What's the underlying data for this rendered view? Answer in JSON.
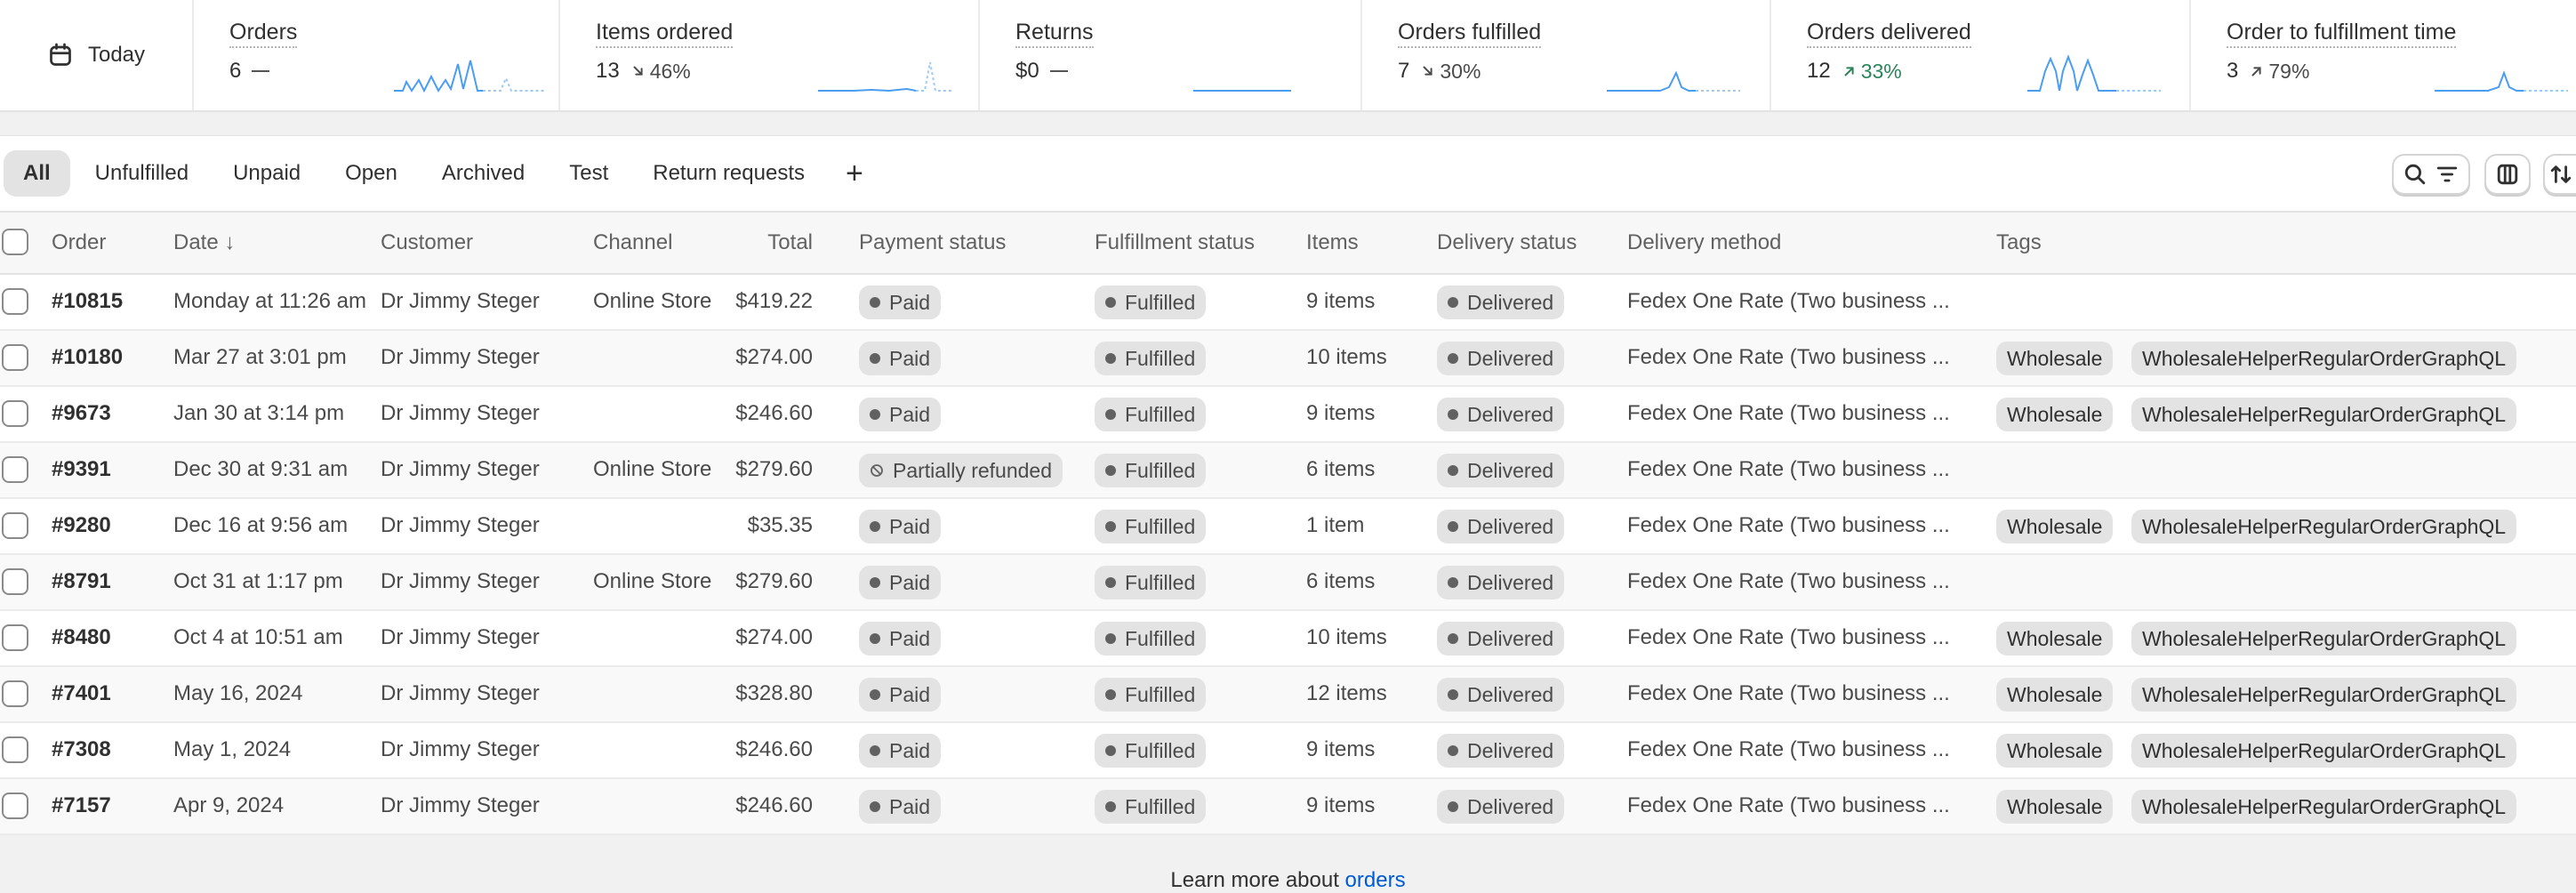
{
  "today_label": "Today",
  "metrics": [
    {
      "title": "Orders",
      "value": "6",
      "change": "",
      "trend": "none"
    },
    {
      "title": "Items ordered",
      "value": "13",
      "change": "46%",
      "trend": "down"
    },
    {
      "title": "Returns",
      "value": "$0",
      "change": "",
      "trend": "none"
    },
    {
      "title": "Orders fulfilled",
      "value": "7",
      "change": "30%",
      "trend": "down"
    },
    {
      "title": "Orders delivered",
      "value": "12",
      "change": "33%",
      "trend": "up"
    },
    {
      "title": "Order to fulfillment time",
      "value": "3",
      "change": "79%",
      "trend": "up-neutral"
    }
  ],
  "tabs": [
    "All",
    "Unfulfilled",
    "Unpaid",
    "Open",
    "Archived",
    "Test",
    "Return requests"
  ],
  "add_tab_label": "+",
  "columns": [
    "Order",
    "Date ↓",
    "Customer",
    "Channel",
    "Total",
    "Payment status",
    "Fulfillment status",
    "Items",
    "Delivery status",
    "Delivery method",
    "Tags"
  ],
  "orders": [
    {
      "order": "#10815",
      "date": "Monday at 11:26 am",
      "customer": "Dr Jimmy Steger",
      "channel": "Online Store",
      "total": "$419.22",
      "payment": "Paid",
      "fulfillment": "Fulfilled",
      "items": "9 items",
      "delivery": "Delivered",
      "method": "Fedex One Rate (Two business ...",
      "tags": []
    },
    {
      "order": "#10180",
      "date": "Mar 27 at 3:01 pm",
      "customer": "Dr Jimmy Steger",
      "channel": "",
      "total": "$274.00",
      "payment": "Paid",
      "fulfillment": "Fulfilled",
      "items": "10 items",
      "delivery": "Delivered",
      "method": "Fedex One Rate (Two business ...",
      "tags": [
        "Wholesale",
        "WholesaleHelperRegularOrderGraphQL"
      ]
    },
    {
      "order": "#9673",
      "date": "Jan 30 at 3:14 pm",
      "customer": "Dr Jimmy Steger",
      "channel": "",
      "total": "$246.60",
      "payment": "Paid",
      "fulfillment": "Fulfilled",
      "items": "9 items",
      "delivery": "Delivered",
      "method": "Fedex One Rate (Two business ...",
      "tags": [
        "Wholesale",
        "WholesaleHelperRegularOrderGraphQL"
      ]
    },
    {
      "order": "#9391",
      "date": "Dec 30 at 9:31 am",
      "customer": "Dr Jimmy Steger",
      "channel": "Online Store",
      "total": "$279.60",
      "payment": "Partially refunded",
      "fulfillment": "Fulfilled",
      "items": "6 items",
      "delivery": "Delivered",
      "method": "Fedex One Rate (Two business ...",
      "tags": []
    },
    {
      "order": "#9280",
      "date": "Dec 16 at 9:56 am",
      "customer": "Dr Jimmy Steger",
      "channel": "",
      "total": "$35.35",
      "payment": "Paid",
      "fulfillment": "Fulfilled",
      "items": "1 item",
      "delivery": "Delivered",
      "method": "Fedex One Rate (Two business ...",
      "tags": [
        "Wholesale",
        "WholesaleHelperRegularOrderGraphQL"
      ]
    },
    {
      "order": "#8791",
      "date": "Oct 31 at 1:17 pm",
      "customer": "Dr Jimmy Steger",
      "channel": "Online Store",
      "total": "$279.60",
      "payment": "Paid",
      "fulfillment": "Fulfilled",
      "items": "6 items",
      "delivery": "Delivered",
      "method": "Fedex One Rate (Two business ...",
      "tags": []
    },
    {
      "order": "#8480",
      "date": "Oct 4 at 10:51 am",
      "customer": "Dr Jimmy Steger",
      "channel": "",
      "total": "$274.00",
      "payment": "Paid",
      "fulfillment": "Fulfilled",
      "items": "10 items",
      "delivery": "Delivered",
      "method": "Fedex One Rate (Two business ...",
      "tags": [
        "Wholesale",
        "WholesaleHelperRegularOrderGraphQL"
      ]
    },
    {
      "order": "#7401",
      "date": "May 16, 2024",
      "customer": "Dr Jimmy Steger",
      "channel": "",
      "total": "$328.80",
      "payment": "Paid",
      "fulfillment": "Fulfilled",
      "items": "12 items",
      "delivery": "Delivered",
      "method": "Fedex One Rate (Two business ...",
      "tags": [
        "Wholesale",
        "WholesaleHelperRegularOrderGraphQL"
      ]
    },
    {
      "order": "#7308",
      "date": "May 1, 2024",
      "customer": "Dr Jimmy Steger",
      "channel": "",
      "total": "$246.60",
      "payment": "Paid",
      "fulfillment": "Fulfilled",
      "items": "9 items",
      "delivery": "Delivered",
      "method": "Fedex One Rate (Two business ...",
      "tags": [
        "Wholesale",
        "WholesaleHelperRegularOrderGraphQL"
      ]
    },
    {
      "order": "#7157",
      "date": "Apr 9, 2024",
      "customer": "Dr Jimmy Steger",
      "channel": "",
      "total": "$246.60",
      "payment": "Paid",
      "fulfillment": "Fulfilled",
      "items": "9 items",
      "delivery": "Delivered",
      "method": "Fedex One Rate (Two business ...",
      "tags": [
        "Wholesale",
        "WholesaleHelperRegularOrderGraphQL"
      ]
    }
  ],
  "footer": {
    "prefix": "Learn more about ",
    "link": "orders"
  },
  "colors": {
    "accent_link": "#005bd3",
    "spark": "#4a9df0",
    "positive": "#29845a",
    "badge_bg": "#e3e3e3"
  },
  "icons": [
    "calendar-icon",
    "search-icon",
    "filter-icon",
    "columns-icon",
    "sort-icon",
    "arrow-down-right-icon",
    "arrow-up-right-icon",
    "refund-icon"
  ]
}
